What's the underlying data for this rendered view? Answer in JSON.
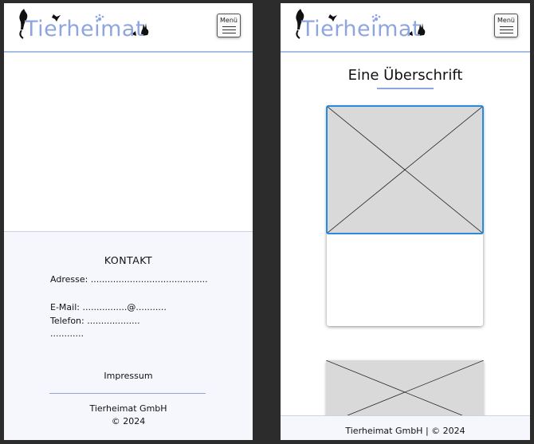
{
  "colors": {
    "background": "#2c2c2c",
    "accent": "#8ea5dd",
    "selection": "#2a8ae0",
    "placeholder": "#d9d9d9",
    "footer_bg": "#f5f7fd"
  },
  "header": {
    "logo_text": "Tierheimat",
    "menu_label": "Menü",
    "icons": [
      "cat-silhouette-icon",
      "bird-silhouette-icon",
      "paw-print-icon",
      "rabbit-silhouette-icon",
      "hamburger-menu-icon"
    ]
  },
  "left_screen": {
    "contact": {
      "title": "KONTAKT",
      "address": "Adresse: ..........................................",
      "email": "E-Mail: ................@...........",
      "phone": "Telefon:  ...................",
      "extra": "............",
      "impressum": "Impressum",
      "company": "Tierheimat GmbH",
      "copyright": "©  2024"
    }
  },
  "right_screen": {
    "heading": "Eine Überschrift",
    "card_image": "image-placeholder",
    "footer": "Tierheimat GmbH  |  ©  2024"
  }
}
